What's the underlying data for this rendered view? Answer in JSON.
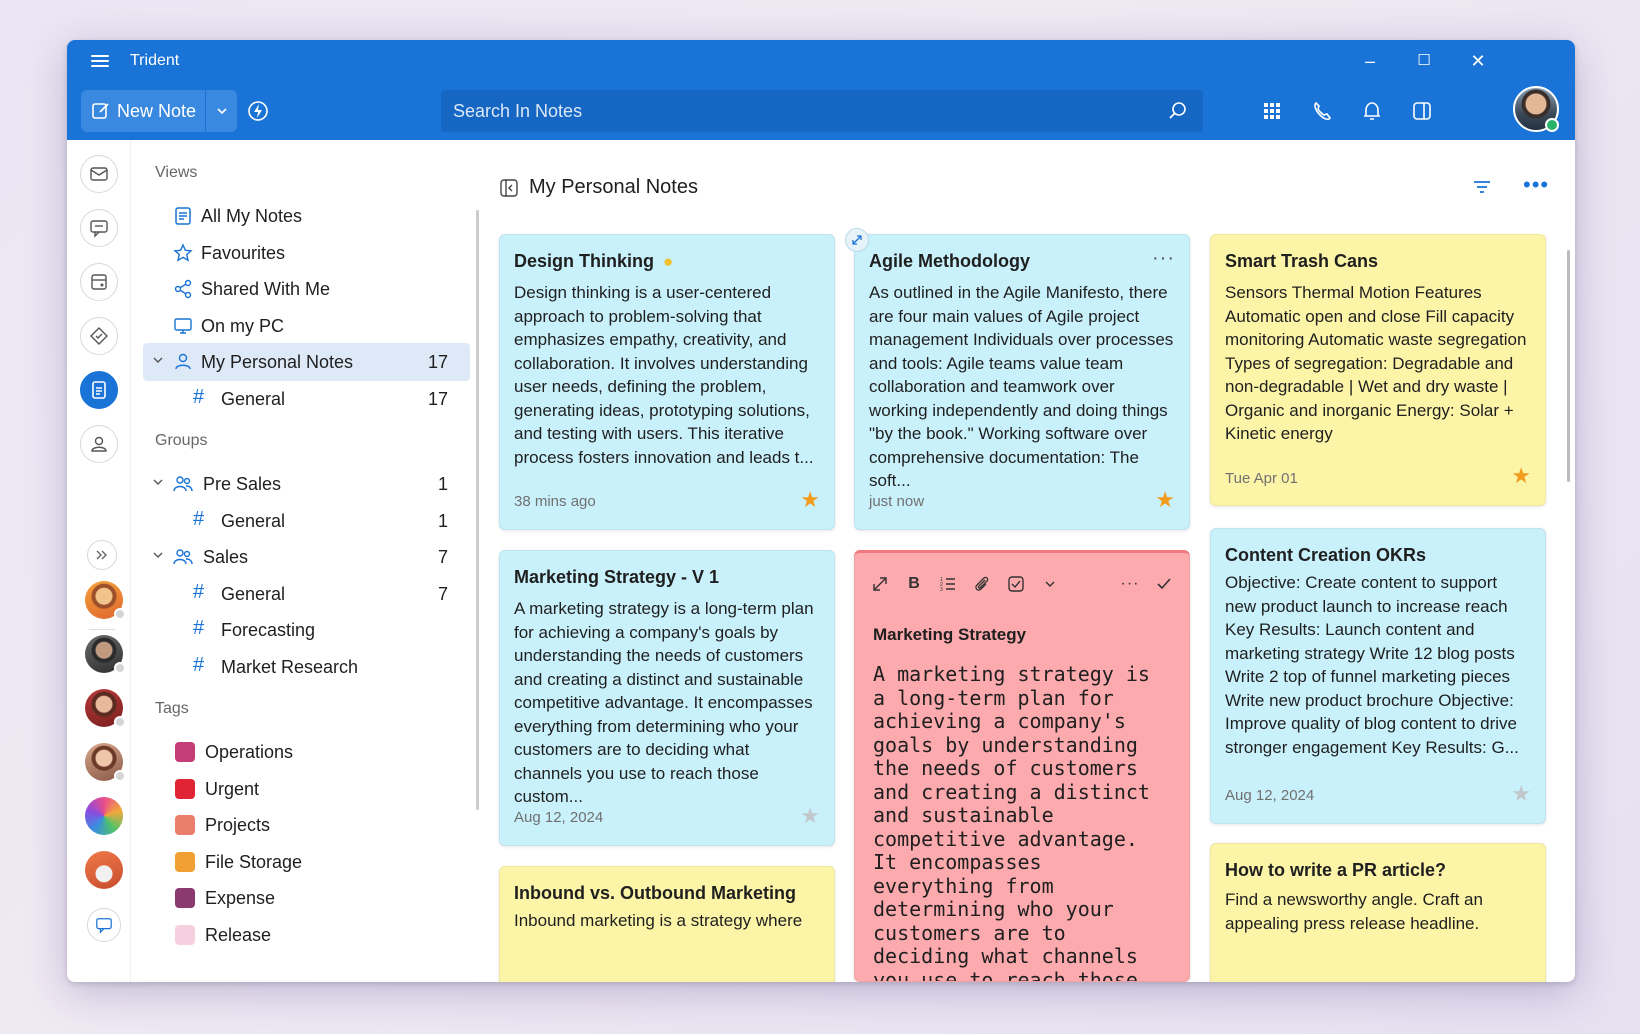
{
  "app": {
    "title": "Trident"
  },
  "window": {
    "minimize": "–",
    "maximize": "☐",
    "close": "✕"
  },
  "header": {
    "new_note_label": "New Note",
    "search_placeholder": "Search In Notes"
  },
  "nav": {
    "views_title": "Views",
    "views": [
      {
        "label": "All My Notes",
        "icon": "notes-icon"
      },
      {
        "label": "Favourites",
        "icon": "star-icon"
      },
      {
        "label": "Shared With Me",
        "icon": "share-icon"
      },
      {
        "label": "On my PC",
        "icon": "monitor-icon"
      },
      {
        "label": "My Personal Notes",
        "icon": "person-icon",
        "count": "17"
      },
      {
        "label": "General",
        "count": "17"
      }
    ],
    "groups_title": "Groups",
    "groups": [
      {
        "label": "Pre Sales",
        "count": "1"
      },
      {
        "label": "General",
        "count": "1"
      },
      {
        "label": "Sales",
        "count": "7"
      },
      {
        "label": "General",
        "count": "7"
      },
      {
        "label": "Forecasting"
      },
      {
        "label": "Market Research"
      }
    ],
    "tags_title": "Tags",
    "tags": [
      {
        "label": "Operations",
        "color": "#c43d77"
      },
      {
        "label": "Urgent",
        "color": "#e02435"
      },
      {
        "label": "Projects",
        "color": "#ea7d6b"
      },
      {
        "label": "File Storage",
        "color": "#f0a032"
      },
      {
        "label": "Expense",
        "color": "#8a3a6e"
      },
      {
        "label": "Release",
        "color": "#f7d0e0"
      }
    ]
  },
  "main": {
    "title": "My Personal Notes",
    "cards": [
      {
        "title": "Design Thinking",
        "body": "Design thinking is a user-centered approach to problem-solving that emphasizes empathy, creativity, and collaboration. It involves understanding user needs, defining the problem, generating ideas, prototyping solutions, and testing with users. This iterative process fosters innovation and leads t...",
        "date": "38 mins ago",
        "favourite": true
      },
      {
        "title": "Agile Methodology",
        "body": "As outlined in the Agile Manifesto, there are four main values of Agile project management Individuals over processes and tools: Agile teams value team collaboration and teamwork over working independently and doing things \"by the book.\" Working software over comprehensive documentation: The soft...",
        "date": "just now",
        "favourite": true
      },
      {
        "title": "Smart Trash Cans",
        "body": "Sensors Thermal Motion Features Automatic open and close Fill capacity monitoring Automatic waste segregation Types of segregation: Degradable and non-degradable | Wet and dry waste | Organic and inorganic Energy: Solar + Kinetic energy",
        "date": "Tue Apr 01",
        "favourite": true
      },
      {
        "title": "Marketing Strategy - V 1",
        "body": "A marketing strategy is a long-term plan for achieving a company's goals by understanding the needs of customers and creating a distinct and sustainable competitive advantage. It encompasses everything from determining who your customers are to deciding what channels you use to reach those custom...",
        "date": "Aug 12, 2024",
        "favourite": false
      },
      {
        "title": "Marketing Strategy",
        "body": "A marketing strategy is a long-term plan for achieving a company's goals by understanding the needs of customers and creating a distinct and sustainable competitive advantage. It encompasses everything from determining who your customers are to deciding what channels you use to reach those customers."
      },
      {
        "title": "Content Creation OKRs",
        "body": "Objective: Create content to support new product launch to increase reach Key Results: Launch content and marketing strategy Write 12 blog posts Write 2 top of funnel marketing pieces Write new product brochure Objective: Improve quality of blog content to drive stronger engagement Key Results: G...",
        "date": "Aug 12, 2024",
        "favourite": false
      },
      {
        "title": "Inbound vs. Outbound Marketing",
        "body": "Inbound marketing is a strategy where"
      },
      {
        "title": "How to write a PR article?",
        "body": "Find a newsworthy angle. Craft an appealing press release headline."
      }
    ]
  },
  "icons": [
    "hamburger-icon",
    "edit-icon",
    "chevron-down-icon",
    "bolt-icon",
    "search-icon",
    "apps-grid-icon",
    "phone-icon",
    "bell-icon",
    "panel-icon",
    "mail-icon",
    "chat-icon",
    "calendar-icon",
    "tag-icon",
    "notes-icon",
    "contact-icon",
    "expand-icon",
    "bold-icon",
    "list-icon",
    "attach-icon",
    "checkbox-icon",
    "check-icon",
    "filter-icon",
    "more-icon",
    "star-icon"
  ]
}
